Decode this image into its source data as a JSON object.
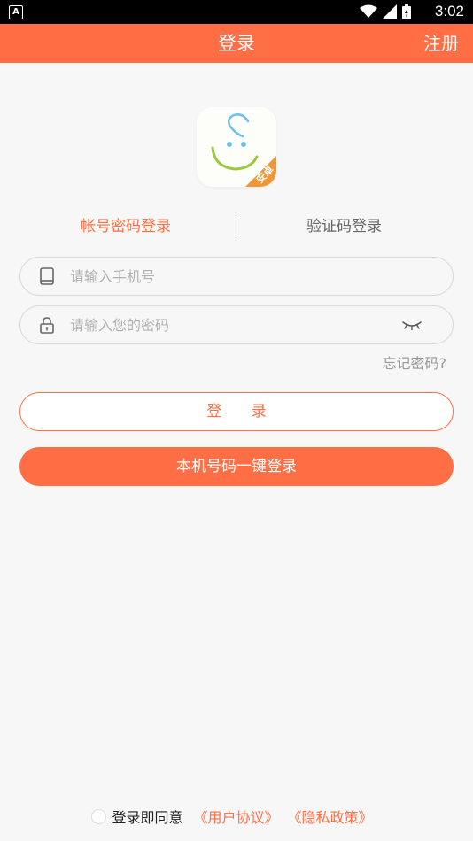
{
  "status_bar": {
    "time": "3:02",
    "left_icon": "A",
    "icons": [
      "wifi-icon",
      "signal-icon",
      "battery-icon"
    ]
  },
  "app_bar": {
    "title": "登录",
    "register_label": "注册",
    "background_color": "#ff6e44"
  },
  "logo": {
    "icon": "app-logo-smiley-icon",
    "badge_text": "安卓"
  },
  "tabs": [
    {
      "label": "帐号密码登录",
      "active": true
    },
    {
      "label": "验证码登录",
      "active": false
    }
  ],
  "phone_field": {
    "placeholder": "请输入手机号",
    "value": "",
    "icon": "phone-icon"
  },
  "password_field": {
    "placeholder": "请输入您的密码",
    "value": "",
    "icon": "lock-icon",
    "toggle_icon": "eye-closed-icon"
  },
  "forgot_password": "忘记密码?",
  "login_button": "登 录",
  "one_key_login_button": "本机号码一键登录",
  "agreement": {
    "prefix": "登录即同意",
    "user_agreement": "《用户协议》",
    "privacy_policy": "《隐私政策》",
    "checked": false
  },
  "colors": {
    "accent": "#ff6e44",
    "background": "#f7f7f7",
    "placeholder": "#b0b0b0"
  }
}
